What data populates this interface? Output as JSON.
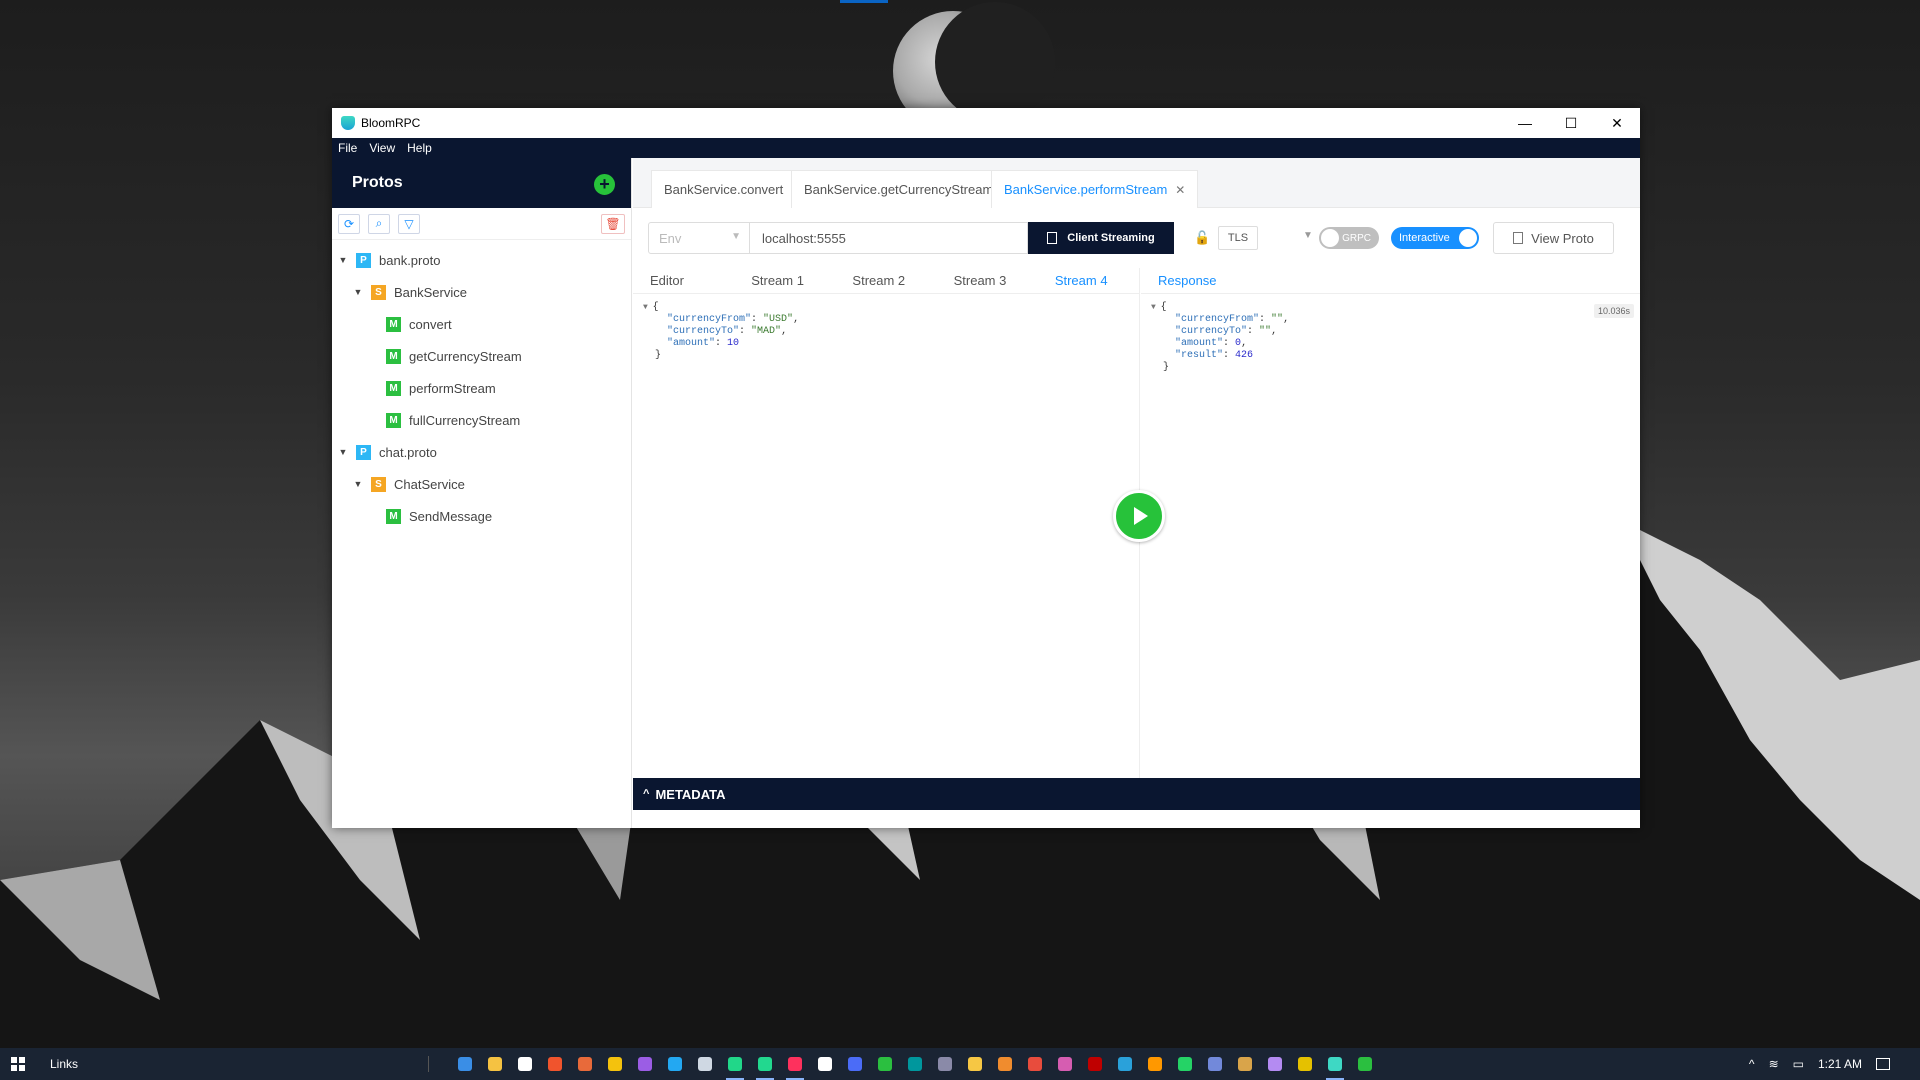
{
  "app": {
    "title": "BloomRPC"
  },
  "window_controls": {
    "minimize": "—",
    "maximize": "☐",
    "close": "✕"
  },
  "menu": [
    "File",
    "View",
    "Help"
  ],
  "sidebar": {
    "title": "Protos",
    "add_icon": "plus-icon",
    "toolbar_icons": [
      "reload-icon",
      "file-search-icon",
      "filter-icon"
    ],
    "delete_icon": "trash-icon",
    "tree": [
      {
        "type": "P",
        "label": "bank.proto",
        "level": 0,
        "caret": true
      },
      {
        "type": "S",
        "label": "BankService",
        "level": 1,
        "caret": true
      },
      {
        "type": "M",
        "label": "convert",
        "level": 2
      },
      {
        "type": "M",
        "label": "getCurrencyStream",
        "level": 2
      },
      {
        "type": "M",
        "label": "performStream",
        "level": 2
      },
      {
        "type": "M",
        "label": "fullCurrencyStream",
        "level": 2
      },
      {
        "type": "P",
        "label": "chat.proto",
        "level": 0,
        "caret": true
      },
      {
        "type": "S",
        "label": "ChatService",
        "level": 1,
        "caret": true
      },
      {
        "type": "M",
        "label": "SendMessage",
        "level": 2
      }
    ]
  },
  "tabs": [
    {
      "label": "BankService.convert",
      "active": false
    },
    {
      "label": "BankService.getCurrencyStream",
      "active": false
    },
    {
      "label": "BankService.performStream",
      "active": true
    }
  ],
  "controls": {
    "env_placeholder": "Env",
    "url": "localhost:5555",
    "streaming_label": "Client Streaming",
    "tls_label": "TLS",
    "grpc_label": "GRPC",
    "interactive_label": "Interactive",
    "view_proto_label": "View Proto"
  },
  "editor": {
    "subtabs": [
      "Editor",
      "Stream 1",
      "Stream 2",
      "Stream 3",
      "Stream 4"
    ],
    "active_subtab": "Stream 4",
    "code": {
      "open": "{",
      "k1": "\"currencyFrom\"",
      "v1": "\"USD\"",
      "k2": "\"currencyTo\"",
      "v2": "\"MAD\"",
      "k3": "\"amount\"",
      "v3": "10",
      "close": "}"
    }
  },
  "response": {
    "label": "Response",
    "time": "10.036s",
    "code": {
      "open": "{",
      "k1": "\"currencyFrom\"",
      "v1": "\"\"",
      "k2": "\"currencyTo\"",
      "v2": "\"\"",
      "k3": "\"amount\"",
      "v3": "0",
      "k4": "\"result\"",
      "v4": "426",
      "close": "}"
    }
  },
  "metadata": {
    "label": "METADATA"
  },
  "taskbar": {
    "links_label": "Links",
    "clock": "1:21 AM",
    "apps": [
      {
        "name": "mail-icon",
        "color": "#3a8ee6"
      },
      {
        "name": "file-explorer-icon",
        "color": "#f5c242"
      },
      {
        "name": "store-icon",
        "color": "#ffffff"
      },
      {
        "name": "brave-icon",
        "color": "#f0542d"
      },
      {
        "name": "git-icon",
        "color": "#e86a3a"
      },
      {
        "name": "chrome-icon",
        "color": "#f4c20d"
      },
      {
        "name": "visual-studio-icon",
        "color": "#9b5de5"
      },
      {
        "name": "vscode-icon",
        "color": "#23a8f2"
      },
      {
        "name": "app-grid-icon",
        "color": "#cfd8e3"
      },
      {
        "name": "pycharm-icon",
        "color": "#21d789"
      },
      {
        "name": "clion-icon",
        "color": "#22d88f"
      },
      {
        "name": "intellij-icon",
        "color": "#fe315d"
      },
      {
        "name": "app-icon",
        "color": "#ffffff"
      },
      {
        "name": "vpn-icon",
        "color": "#4b6cf7"
      },
      {
        "name": "spinner-icon",
        "color": "#2bbf40"
      },
      {
        "name": "arduino-icon",
        "color": "#00979d"
      },
      {
        "name": "bar-icon",
        "color": "#8a8aa8"
      },
      {
        "name": "star-icon",
        "color": "#f6c744"
      },
      {
        "name": "sun-icon",
        "color": "#f08c2e"
      },
      {
        "name": "p-icon",
        "color": "#e84c3d"
      },
      {
        "name": "colorful-icon",
        "color": "#d65db1"
      },
      {
        "name": "filezilla-icon",
        "color": "#bf0000"
      },
      {
        "name": "telegram-icon",
        "color": "#2aa1da"
      },
      {
        "name": "sublime-icon",
        "color": "#ff9800"
      },
      {
        "name": "whatsapp-icon",
        "color": "#25d366"
      },
      {
        "name": "discord-icon",
        "color": "#7289da"
      },
      {
        "name": "folder-icon",
        "color": "#d9a44a"
      },
      {
        "name": "github-icon",
        "color": "#b48bf2"
      },
      {
        "name": "coin-icon",
        "color": "#e5c100"
      },
      {
        "name": "bloomrpc-icon",
        "color": "#3ed8c4"
      },
      {
        "name": "loader-icon",
        "color": "#2bbf40"
      }
    ]
  }
}
